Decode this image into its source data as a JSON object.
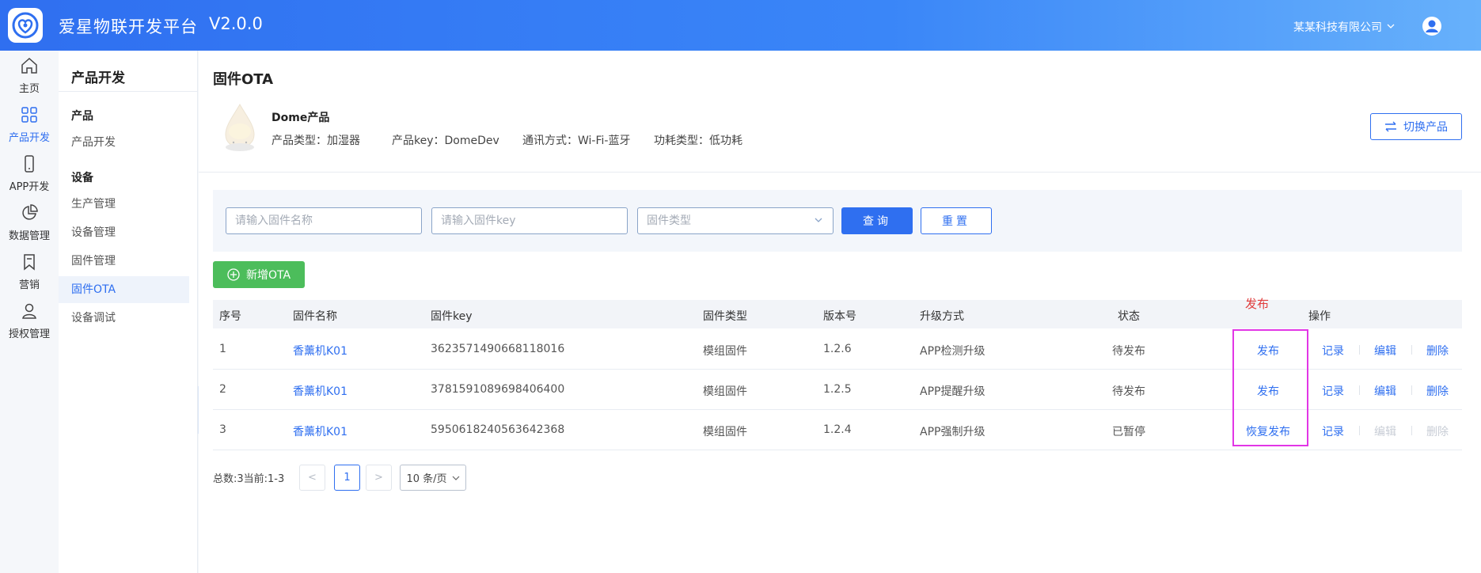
{
  "header": {
    "app_title": "爱星物联开发平台",
    "version": "V2.0.0",
    "org_name": "某某科技有限公司",
    "org_icon": "chevron-down-icon",
    "avatar_icon": "user-avatar-icon"
  },
  "rail": {
    "items": [
      {
        "label": "主页",
        "icon": "home-icon"
      },
      {
        "label": "产品开发",
        "icon": "grid-icon",
        "active": true
      },
      {
        "label": "APP开发",
        "icon": "phone-icon"
      },
      {
        "label": "数据管理",
        "icon": "pie-chart-icon"
      },
      {
        "label": "营销",
        "icon": "bookmark-icon"
      },
      {
        "label": "授权管理",
        "icon": "user-icon"
      }
    ]
  },
  "submenu": {
    "title": "产品开发",
    "groups": [
      {
        "label": "产品",
        "items": [
          "产品开发"
        ]
      },
      {
        "label": "设备",
        "items": [
          "生产管理",
          "设备管理",
          "固件管理",
          "固件OTA",
          "设备调试"
        ]
      }
    ],
    "active_item": "固件OTA"
  },
  "page": {
    "title": "固件OTA",
    "product": {
      "name": "Dome产品",
      "type_text": "产品类型：加湿器",
      "key_text": "产品key：DomeDev",
      "comm_text": "通讯方式：Wi-Fi-蓝牙",
      "power_text": "功耗类型：低功耗"
    },
    "switch_label": "切换产品",
    "filter": {
      "name_placeholder": "请输入固件名称",
      "key_placeholder": "请输入固件key",
      "type_placeholder": "固件类型",
      "query_label": "查询",
      "reset_label": "重置"
    },
    "add_label": "新增OTA"
  },
  "table": {
    "headers": [
      "序号",
      "固件名称",
      "固件key",
      "固件类型",
      "版本号",
      "升级方式",
      "状态",
      "操作"
    ],
    "rows": [
      {
        "no": "1",
        "name": "香薰机K01",
        "key": "3623571490668118016",
        "type": "模组固件",
        "version": "1.2.6",
        "upgrade": "APP检测升级",
        "status": "待发布",
        "ops": {
          "publish": "发布",
          "record": "记录",
          "edit": "编辑",
          "delete": "删除"
        },
        "ops_disabled": false
      },
      {
        "no": "2",
        "name": "香薰机K01",
        "key": "3781591089698406400",
        "type": "模组固件",
        "version": "1.2.5",
        "upgrade": "APP提醒升级",
        "status": "待发布",
        "ops": {
          "publish": "发布",
          "record": "记录",
          "edit": "编辑",
          "delete": "删除"
        },
        "ops_disabled": false
      },
      {
        "no": "3",
        "name": "香薰机K01",
        "key": "5950618240563642368",
        "type": "模组固件",
        "version": "1.2.4",
        "upgrade": "APP强制升级",
        "status": "已暂停",
        "ops": {
          "publish": "恢复发布",
          "record": "记录",
          "edit": "编辑",
          "delete": "删除"
        },
        "ops_disabled": true
      }
    ]
  },
  "annotation": {
    "label": "发布",
    "color": "#e03b3b",
    "box_color": "#e236e6"
  },
  "pager": {
    "summary": "总数:3当前:1-3",
    "current_page": "1",
    "prev": "<",
    "next": ">",
    "page_size": "10 条/页"
  },
  "colors": {
    "primary": "#2f6ff0",
    "add_button": "#4cbd5b"
  }
}
